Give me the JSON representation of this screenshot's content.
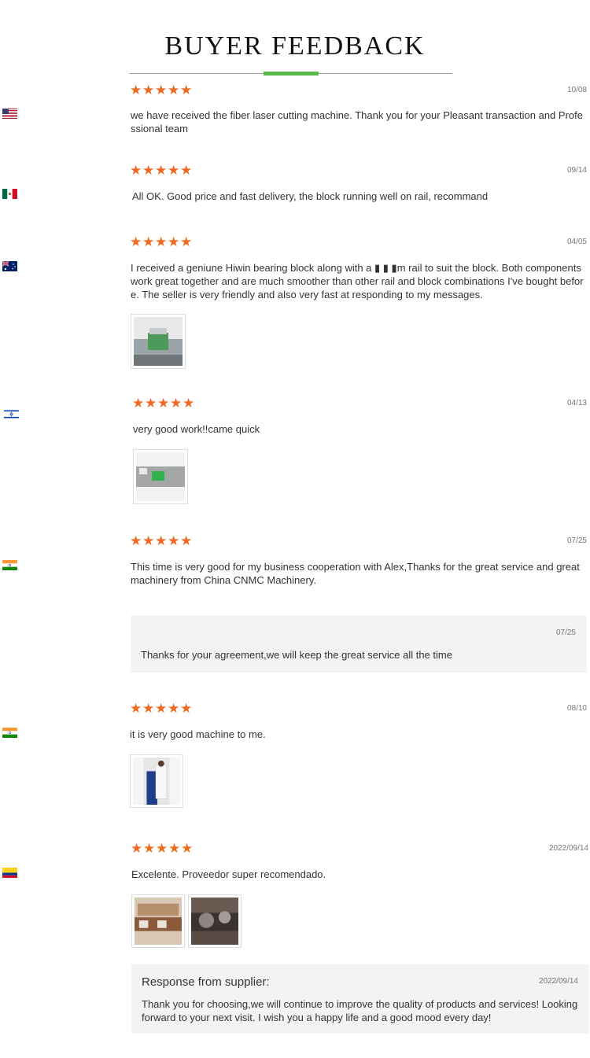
{
  "header": {
    "title": "BUYER FEEDBACK"
  },
  "colors": {
    "accent": "#5bb94b",
    "star": "#f26a22",
    "reply_bg": "#f3f3f3"
  },
  "rating_max": 5,
  "reviews": [
    {
      "flag": "us-flag-icon",
      "rating": 5,
      "date": "10/08",
      "text": "we have received the fiber laser cutting machine. Thank you for your Pleasant transaction and Professional team"
    },
    {
      "flag": "mexico-flag-icon",
      "rating": 5,
      "date": "09/14",
      "text": "All OK. Good price and fast delivery, the block running well on rail, recommand"
    },
    {
      "flag": "australia-flag-icon",
      "rating": 5,
      "date": "04/05",
      "text": "I received a geniune Hiwin bearing block along with a ▮ ▮ ▮m rail to suit the block. Both components work great together and are much smoother than other rail and block combinations I've bought before. The seller is very friendly and also very fast at responding to my messages."
    },
    {
      "flag": "israel-flag-icon",
      "rating": 5,
      "date": "04/13",
      "text": "very good work!!came quick"
    },
    {
      "flag": "india-flag-icon",
      "rating": 5,
      "date": "07/25",
      "text": "This time is very good for my business cooperation with Alex,Thanks for the great service and great machinery from China CNMC Machinery.",
      "reply": {
        "date": "07/25",
        "text": "Thanks for your agreement,we will keep the great service all the time"
      }
    },
    {
      "flag": "india-flag-icon",
      "rating": 5,
      "date": "08/10",
      "text": "it is very good machine to me."
    },
    {
      "flag": "colombia-flag-icon",
      "rating": 5,
      "date": "2022/09/14",
      "text": "Excelente. Proveedor super recomendado.",
      "reply": {
        "heading": "Response from supplier:",
        "date": "2022/09/14",
        "text": "Thank you for choosing,we will continue to improve the quality of products and services! Looking forward to your next visit. I wish you a happy life and a good mood every day!"
      }
    }
  ]
}
